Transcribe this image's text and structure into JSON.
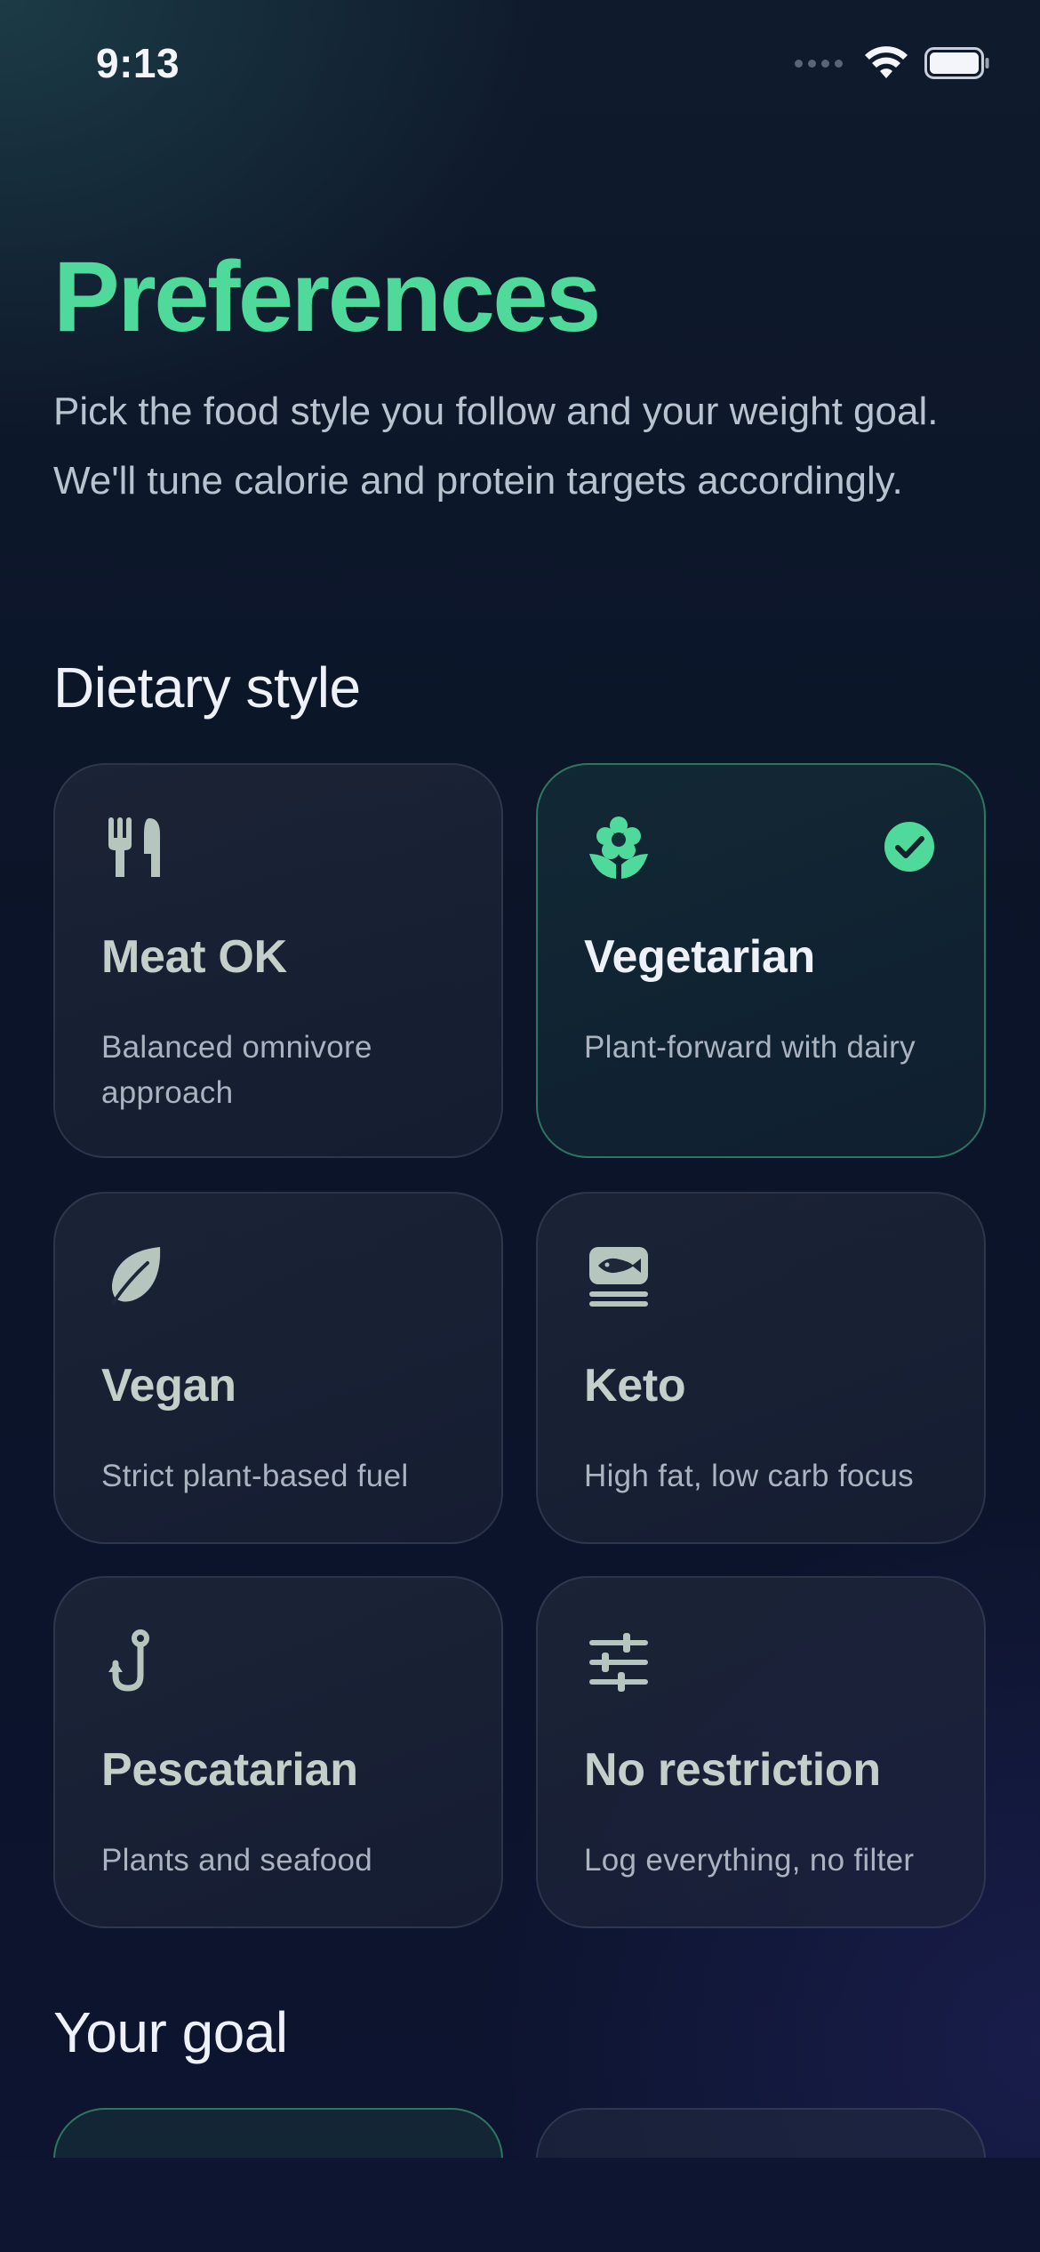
{
  "status_bar": {
    "time": "9:13"
  },
  "header": {
    "title": "Preferences",
    "subtitle": "Pick the food style you follow and your weight goal. We'll tune calorie and protein targets accordingly."
  },
  "dietary_section": {
    "heading": "Dietary style",
    "options": [
      {
        "title": "Meat OK",
        "description": "Balanced omnivore approach",
        "icon": "fork-knife-icon",
        "selected": false
      },
      {
        "title": "Vegetarian",
        "description": "Plant-forward with dairy",
        "icon": "flower-icon",
        "selected": true
      },
      {
        "title": "Vegan",
        "description": "Strict plant-based fuel",
        "icon": "leaf-icon",
        "selected": false
      },
      {
        "title": "Keto",
        "description": "High fat, low carb focus",
        "icon": "fish-plate-icon",
        "selected": false
      },
      {
        "title": "Pescatarian",
        "description": "Plants and seafood",
        "icon": "fish-hook-icon",
        "selected": false
      },
      {
        "title": "No restriction",
        "description": "Log everything, no filter",
        "icon": "sliders-icon",
        "selected": false
      }
    ]
  },
  "goal_section": {
    "heading": "Your goal"
  },
  "colors": {
    "accent": "#4fd99a",
    "icon_muted": "#b7c5bf",
    "background": "#0b1226",
    "text_primary": "#eef1f8",
    "text_secondary": "#aab3bf"
  }
}
